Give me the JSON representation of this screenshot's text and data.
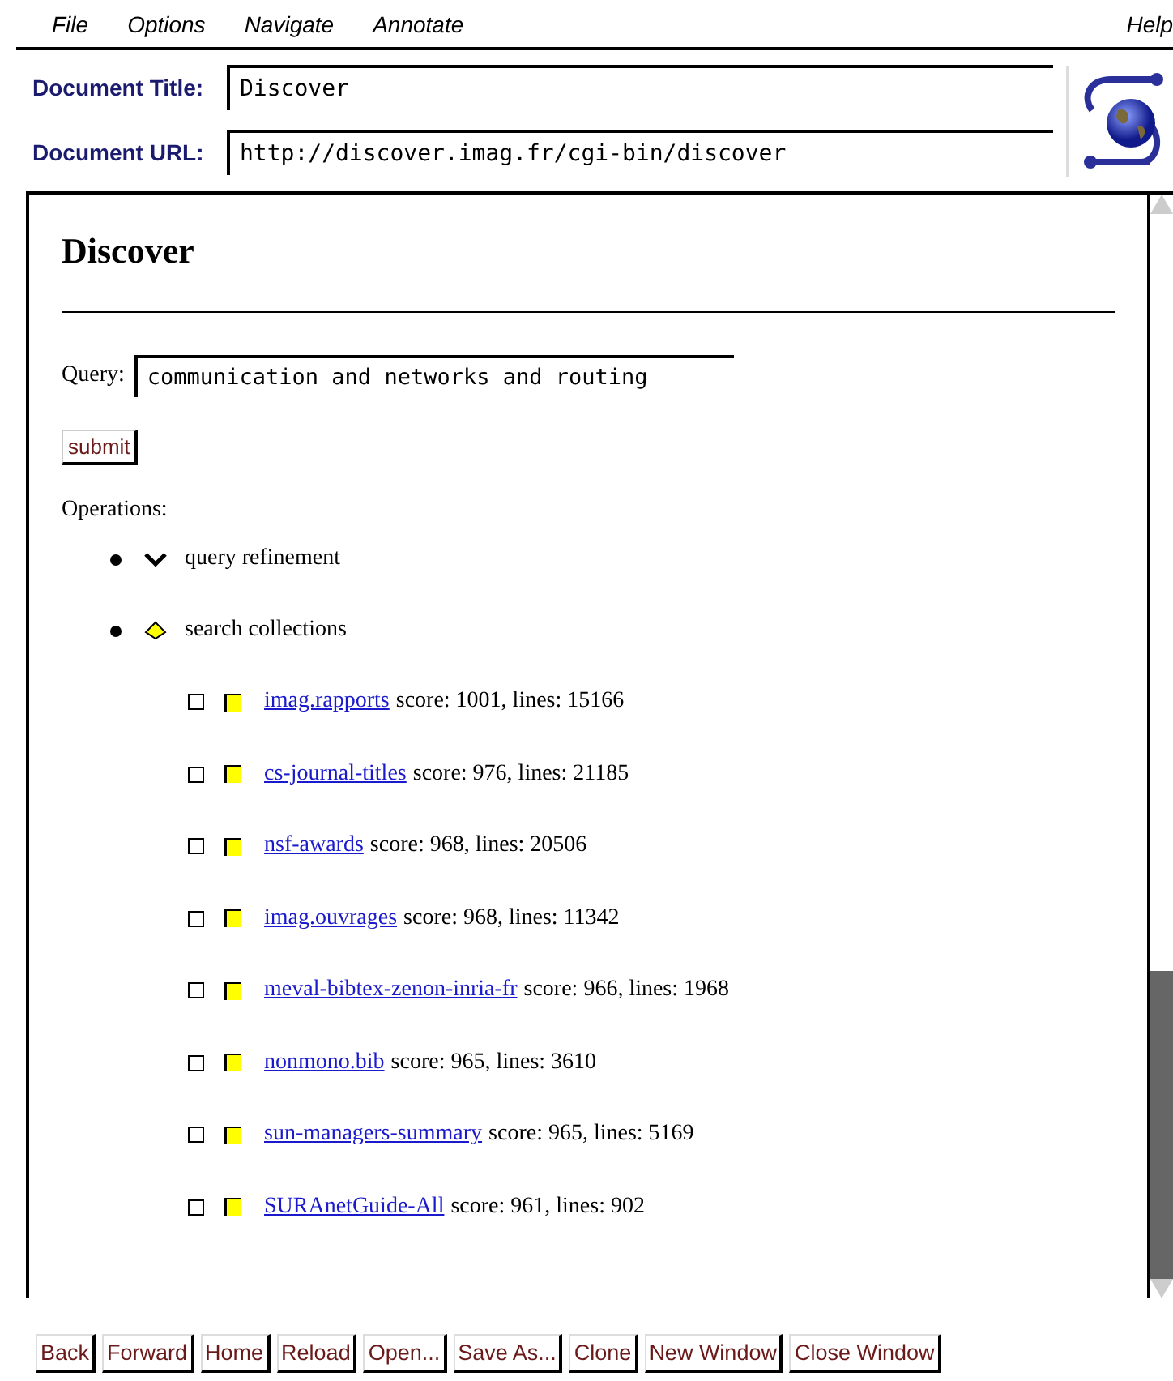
{
  "menu": [
    {
      "label": "File"
    },
    {
      "label": "Options"
    },
    {
      "label": "Navigate"
    },
    {
      "label": "Annotate"
    }
  ],
  "help": "Help",
  "document_title": {
    "label": "Document Title:",
    "value": "Discover"
  },
  "document_url": {
    "label": "Document URL:",
    "value": "http://discover.imag.fr/cgi-bin/discover"
  },
  "page": {
    "heading": "Discover",
    "query_label": "Query:",
    "query_value": "communication and networks and routing",
    "submit": "submit",
    "operations_label": "Operations:",
    "operations": [
      {
        "label": "query refinement",
        "expanded": false
      },
      {
        "label": "search collections",
        "expanded": true,
        "children": [
          {
            "link": "imag.rapports",
            "info": "score: 1001, lines: 15166",
            "checked": false
          },
          {
            "link": "cs-journal-titles",
            "info": "score: 976, lines: 21185",
            "checked": false
          },
          {
            "link": "nsf-awards",
            "info": "score: 968, lines: 20506",
            "checked": false
          },
          {
            "link": "imag.ouvrages",
            "info": "score: 968, lines: 11342",
            "checked": false
          },
          {
            "link": "meval-bibtex-zenon-inria-fr",
            "info": "score: 966, lines: 1968",
            "checked": false
          },
          {
            "link": "nonmono.bib",
            "info": "score: 965, lines: 3610",
            "checked": false
          },
          {
            "link": "sun-managers-summary",
            "info": "score: 965, lines: 5169",
            "checked": false
          },
          {
            "link": "SURAnetGuide-All",
            "info": "score: 961, lines: 902",
            "checked": false
          }
        ]
      }
    ]
  },
  "buttons": [
    "Back",
    "Forward",
    "Home",
    "Reload",
    "Open...",
    "Save As...",
    "Clone",
    "New Window",
    "Close Window"
  ]
}
